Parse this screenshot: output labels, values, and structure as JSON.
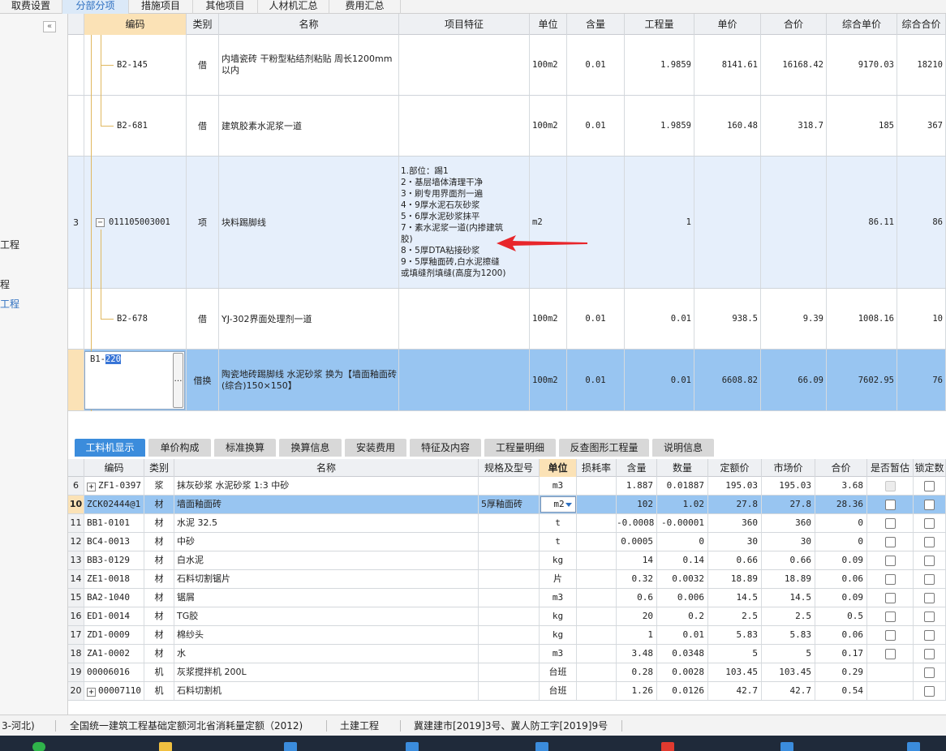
{
  "top_tabs": [
    {
      "label": "取费设置",
      "active": false
    },
    {
      "label": "分部分项",
      "active": true
    },
    {
      "label": "措施项目",
      "active": false
    },
    {
      "label": "其他项目",
      "active": false
    },
    {
      "label": "人材机汇总",
      "active": false
    },
    {
      "label": "费用汇总",
      "active": false
    }
  ],
  "left_panel": {
    "collapse_glyph": "«",
    "items": [
      "工程",
      "程",
      "工程"
    ]
  },
  "upper_grid": {
    "headers": [
      "编码",
      "类别",
      "名称",
      "项目特征",
      "单位",
      "含量",
      "工程量",
      "单价",
      "合价",
      "综合单价",
      "综合合价"
    ],
    "rows": [
      {
        "num": "",
        "code": "B2-145",
        "type": "借",
        "name": "内墙瓷砖 干粉型粘结剂粘贴 周长1200mm以内",
        "feature": "",
        "unit": "100m2",
        "content": "0.01",
        "qty": "1.9859",
        "price": "8141.61",
        "total": "16168.42",
        "comp_price": "9170.03",
        "comp_total": "18210"
      },
      {
        "num": "",
        "code": "B2-681",
        "type": "借",
        "name": "建筑胶素水泥浆一道",
        "feature": "",
        "unit": "100m2",
        "content": "0.01",
        "qty": "1.9859",
        "price": "160.48",
        "total": "318.7",
        "comp_price": "185",
        "comp_total": "367"
      },
      {
        "num": "3",
        "code": "011105003001",
        "type": "项",
        "name": "块料踢脚线",
        "feature": "1.部位：踢1\n2・基层墙体清理干净\n3・刷专用界面剂一遍\n4・9厚水泥石灰砂浆\n5・6厚水泥砂浆抹平\n7・素水泥浆一道(内掺建筑\n胶)\n8・5厚DTA粘接砂浆\n9・5厚釉面砖,白水泥擦缝\n或填缝剂填缝(高度为1200)",
        "unit": "m2",
        "content": "",
        "qty": "1",
        "price": "",
        "total": "",
        "comp_price": "86.11",
        "comp_total": "86"
      },
      {
        "num": "",
        "code": "B2-678",
        "type": "借",
        "name": "YJ-302界面处理剂一道",
        "feature": "",
        "unit": "100m2",
        "content": "0.01",
        "qty": "0.01",
        "price": "938.5",
        "total": "9.39",
        "comp_price": "1008.16",
        "comp_total": "10"
      },
      {
        "num": "",
        "code": "",
        "type": "借换",
        "name": "陶瓷地砖踢脚线 水泥砂浆  换为【墙面釉面砖(综合)150×150】",
        "feature": "",
        "unit": "100m2",
        "content": "0.01",
        "qty": "0.01",
        "price": "6608.82",
        "total": "66.09",
        "comp_price": "7602.95",
        "comp_total": "76"
      }
    ],
    "edit_value_prefix": "B1-",
    "edit_value_selected": "220",
    "edit_button": "…"
  },
  "bottom_tabs": [
    {
      "label": "工料机显示",
      "active": true
    },
    {
      "label": "单价构成",
      "active": false
    },
    {
      "label": "标准换算",
      "active": false
    },
    {
      "label": "换算信息",
      "active": false
    },
    {
      "label": "安装费用",
      "active": false
    },
    {
      "label": "特征及内容",
      "active": false
    },
    {
      "label": "工程量明细",
      "active": false
    },
    {
      "label": "反查图形工程量",
      "active": false
    },
    {
      "label": "说明信息",
      "active": false
    }
  ],
  "lower_grid": {
    "headers": [
      "编码",
      "类别",
      "名称",
      "规格及型号",
      "单位",
      "损耗率",
      "含量",
      "数量",
      "定额价",
      "市场价",
      "合价",
      "是否暂估",
      "锁定数"
    ],
    "rows": [
      {
        "num": "6",
        "expand": true,
        "code": "ZF1-0397",
        "type": "浆",
        "name": "抹灰砂浆 水泥砂浆 1:3 中砂",
        "spec": "",
        "unit": "m3",
        "loss": "",
        "content": "1.887",
        "qty": "0.01887",
        "base": "195.03",
        "market": "195.03",
        "total": "3.68",
        "est": "disabled",
        "lock": true,
        "sel": false
      },
      {
        "num": "10",
        "expand": false,
        "code": "ZCK02444@1",
        "type": "材",
        "name": "墙面釉面砖",
        "spec": "5厚釉面砖",
        "unit": "m2",
        "loss": "",
        "content": "102",
        "qty": "1.02",
        "base": "27.8",
        "market": "27.8",
        "total": "28.36",
        "est": "box",
        "lock": true,
        "sel": true
      },
      {
        "num": "11",
        "expand": false,
        "code": "BB1-0101",
        "type": "材",
        "name": "水泥 32.5",
        "spec": "",
        "unit": "t",
        "loss": "",
        "content": "-0.0008",
        "qty": "-0.00001",
        "base": "360",
        "market": "360",
        "total": "0",
        "est": "box",
        "lock": true,
        "sel": false
      },
      {
        "num": "12",
        "expand": false,
        "code": "BC4-0013",
        "type": "材",
        "name": "中砂",
        "spec": "",
        "unit": "t",
        "loss": "",
        "content": "0.0005",
        "qty": "0",
        "base": "30",
        "market": "30",
        "total": "0",
        "est": "box",
        "lock": true,
        "sel": false
      },
      {
        "num": "13",
        "expand": false,
        "code": "BB3-0129",
        "type": "材",
        "name": "白水泥",
        "spec": "",
        "unit": "kg",
        "loss": "",
        "content": "14",
        "qty": "0.14",
        "base": "0.66",
        "market": "0.66",
        "total": "0.09",
        "est": "box",
        "lock": true,
        "sel": false
      },
      {
        "num": "14",
        "expand": false,
        "code": "ZE1-0018",
        "type": "材",
        "name": "石料切割锯片",
        "spec": "",
        "unit": "片",
        "loss": "",
        "content": "0.32",
        "qty": "0.0032",
        "base": "18.89",
        "market": "18.89",
        "total": "0.06",
        "est": "box",
        "lock": true,
        "sel": false
      },
      {
        "num": "15",
        "expand": false,
        "code": "BA2-1040",
        "type": "材",
        "name": "锯屑",
        "spec": "",
        "unit": "m3",
        "loss": "",
        "content": "0.6",
        "qty": "0.006",
        "base": "14.5",
        "market": "14.5",
        "total": "0.09",
        "est": "box",
        "lock": true,
        "sel": false
      },
      {
        "num": "16",
        "expand": false,
        "code": "ED1-0014",
        "type": "材",
        "name": "TG胶",
        "spec": "",
        "unit": "kg",
        "loss": "",
        "content": "20",
        "qty": "0.2",
        "base": "2.5",
        "market": "2.5",
        "total": "0.5",
        "est": "box",
        "lock": true,
        "sel": false
      },
      {
        "num": "17",
        "expand": false,
        "code": "ZD1-0009",
        "type": "材",
        "name": "棉纱头",
        "spec": "",
        "unit": "kg",
        "loss": "",
        "content": "1",
        "qty": "0.01",
        "base": "5.83",
        "market": "5.83",
        "total": "0.06",
        "est": "box",
        "lock": true,
        "sel": false
      },
      {
        "num": "18",
        "expand": false,
        "code": "ZA1-0002",
        "type": "材",
        "name": "水",
        "spec": "",
        "unit": "m3",
        "loss": "",
        "content": "3.48",
        "qty": "0.0348",
        "base": "5",
        "market": "5",
        "total": "0.17",
        "est": "box",
        "lock": true,
        "sel": false
      },
      {
        "num": "19",
        "expand": false,
        "code": "00006016",
        "type": "机",
        "name": "灰浆搅拌机 200L",
        "spec": "",
        "unit": "台班",
        "loss": "",
        "content": "0.28",
        "qty": "0.0028",
        "base": "103.45",
        "market": "103.45",
        "total": "0.29",
        "est": "none",
        "lock": true,
        "sel": false
      },
      {
        "num": "20",
        "expand": true,
        "code": "00007110",
        "type": "机",
        "name": "石料切割机",
        "spec": "",
        "unit": "台班",
        "loss": "",
        "content": "1.26",
        "qty": "0.0126",
        "base": "42.7",
        "market": "42.7",
        "total": "0.54",
        "est": "none",
        "lock": true,
        "sel": false
      }
    ]
  },
  "status_bar": {
    "items": [
      "3-河北)",
      "全国统一建筑工程基础定额河北省消耗量定额（2012)",
      "土建工程",
      "冀建建市[2019]3号、冀人防工字[2019]9号"
    ]
  },
  "colors": {
    "accent": "#3b8cdc",
    "selected_row": "#98c5f1",
    "light_row": "#e6effb",
    "header_selected": "#fbe2b6",
    "arrow": "#e8262b"
  }
}
